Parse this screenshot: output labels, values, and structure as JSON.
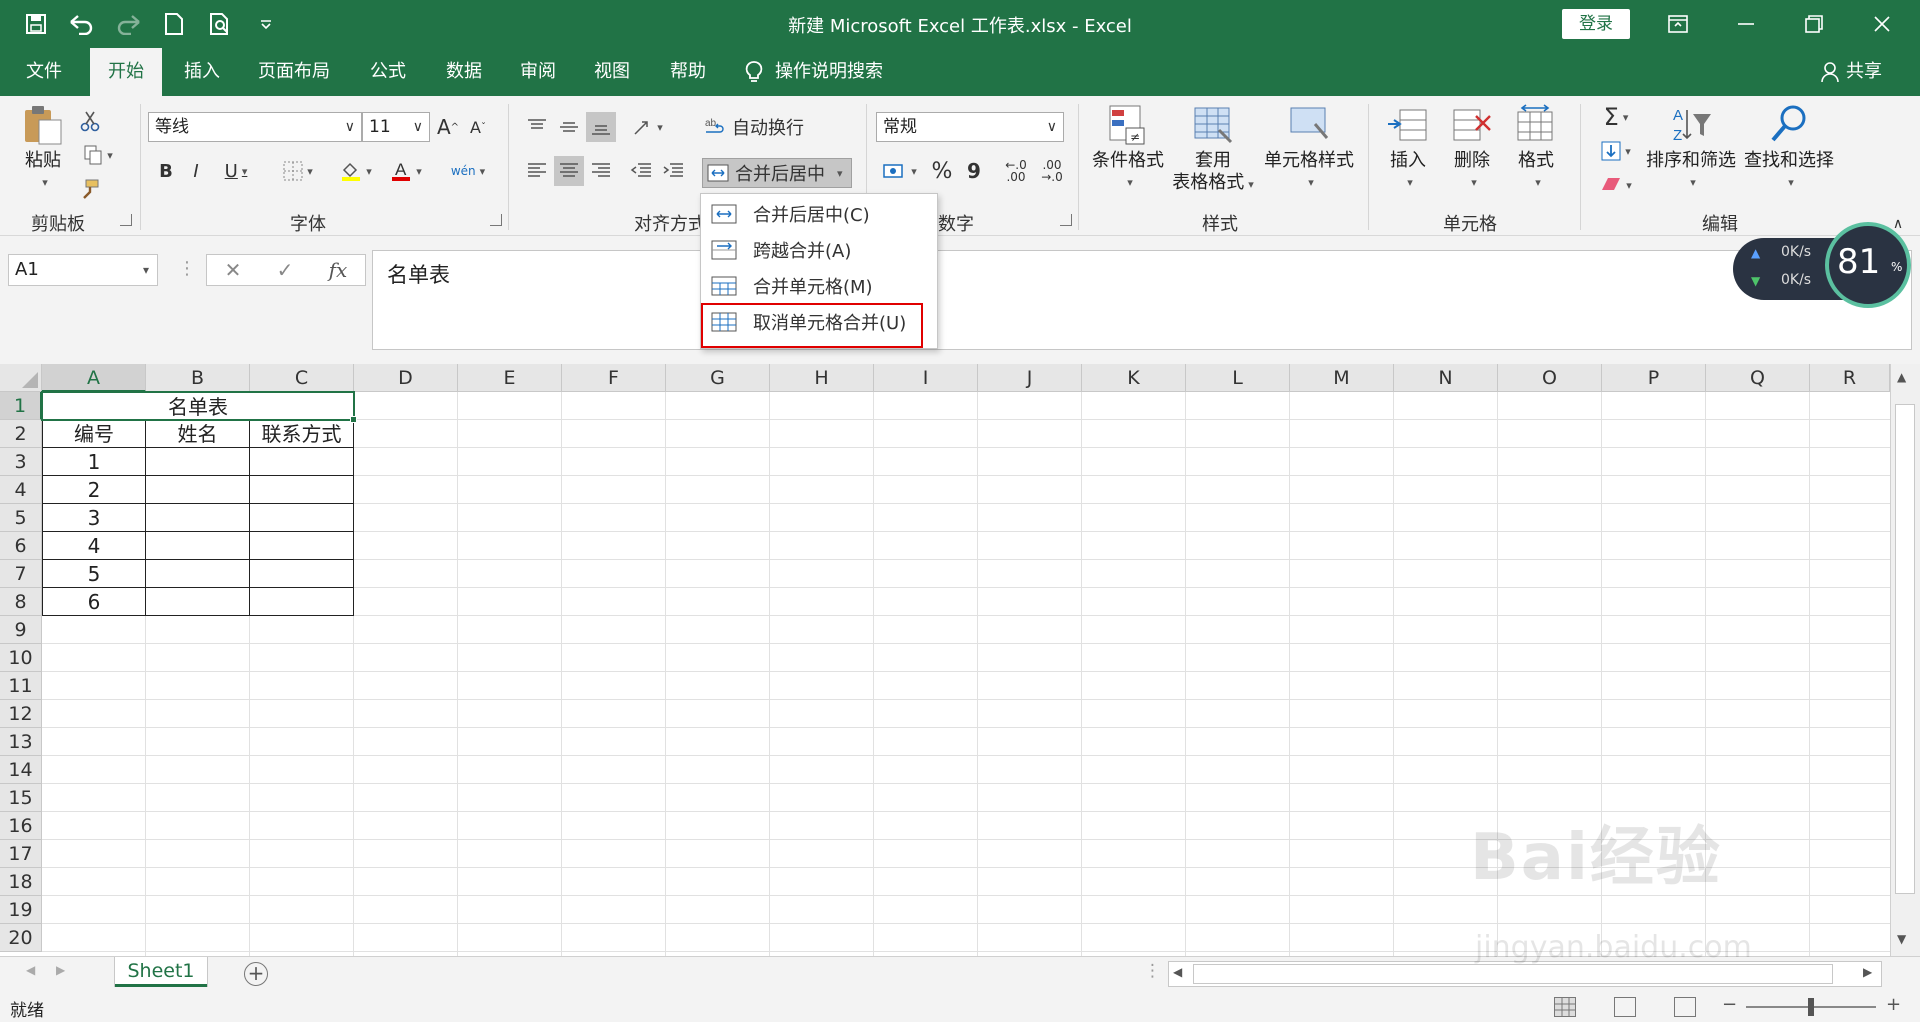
{
  "window": {
    "title": "新建 Microsoft Excel 工作表.xlsx  -  Excel",
    "login_label": "登录",
    "qat_icons": [
      "save-icon",
      "undo-icon",
      "redo-icon",
      "new-file-icon",
      "print-preview-icon",
      "customize-qat-icon"
    ],
    "controls": [
      "ribbon-display-icon",
      "minimize-icon",
      "restore-icon",
      "close-icon"
    ]
  },
  "tabs": [
    {
      "label": "文件",
      "active": false
    },
    {
      "label": "开始",
      "active": true
    },
    {
      "label": "插入",
      "active": false
    },
    {
      "label": "页面布局",
      "active": false
    },
    {
      "label": "公式",
      "active": false
    },
    {
      "label": "数据",
      "active": false
    },
    {
      "label": "审阅",
      "active": false
    },
    {
      "label": "视图",
      "active": false
    },
    {
      "label": "帮助",
      "active": false
    }
  ],
  "tell_me": "操作说明搜索",
  "share": "共享",
  "ribbon": {
    "clipboard": {
      "paste": "粘贴",
      "group": "剪贴板"
    },
    "font": {
      "name": "等线",
      "size": "11",
      "grow": "A",
      "shrink": "A",
      "bold": "B",
      "italic": "I",
      "underline": "U",
      "phonetic": "wén",
      "group": "字体"
    },
    "alignment": {
      "wrap_text": "自动换行",
      "merge_center": "合并后居中",
      "group": "对齐方式"
    },
    "number": {
      "format": "常规",
      "percent": "%",
      "comma": "9",
      "inc_decimal": ".00",
      "dec_decimal": ".0",
      "group": "数字"
    },
    "styles": {
      "conditional": "条件格式",
      "table_line1": "套用",
      "table_line2": "表格格式",
      "cell_styles": "单元格样式",
      "group": "样式"
    },
    "cells": {
      "insert": "插入",
      "delete": "删除",
      "format": "格式",
      "group": "单元格"
    },
    "editing": {
      "sort_filter": "排序和筛选",
      "find_select": "查找和选择",
      "group": "编辑"
    }
  },
  "merge_menu": {
    "items": [
      {
        "label": "合并后居中(C)",
        "icon": "merge-center-icon"
      },
      {
        "label": "跨越合并(A)",
        "icon": "merge-across-icon"
      },
      {
        "label": "合并单元格(M)",
        "icon": "merge-cells-icon"
      },
      {
        "label": "取消单元格合并(U)",
        "icon": "unmerge-cells-icon",
        "highlighted": true
      }
    ]
  },
  "formula_bar": {
    "name_box": "A1",
    "cancel": "✕",
    "enter": "✓",
    "fx": "fx",
    "content": "名单表"
  },
  "grid": {
    "columns": [
      "A",
      "B",
      "C",
      "D",
      "E",
      "F",
      "G",
      "H",
      "I",
      "J",
      "K",
      "L",
      "M",
      "N",
      "O",
      "P",
      "Q",
      "R"
    ],
    "rows": [
      "1",
      "2",
      "3",
      "4",
      "5",
      "6",
      "7",
      "8",
      "9",
      "10",
      "11",
      "12",
      "13",
      "14",
      "15",
      "16",
      "17",
      "18",
      "19",
      "20"
    ],
    "selected_cell": "A1",
    "merged_title": "名单表",
    "headers": [
      "编号",
      "姓名",
      "联系方式"
    ],
    "numbers": [
      "1",
      "2",
      "3",
      "4",
      "5",
      "6"
    ]
  },
  "sheet_tabs": {
    "active": "Sheet1",
    "add": "+"
  },
  "status": {
    "ready": "就绪",
    "zoom_minus": "−",
    "zoom_plus": "+"
  },
  "net_widget": {
    "up": "0K/s",
    "down": "0K/s",
    "percent": "81",
    "unit": "%"
  },
  "watermark": {
    "brand": "Bai经验",
    "url": "jingyan.baidu.com"
  }
}
